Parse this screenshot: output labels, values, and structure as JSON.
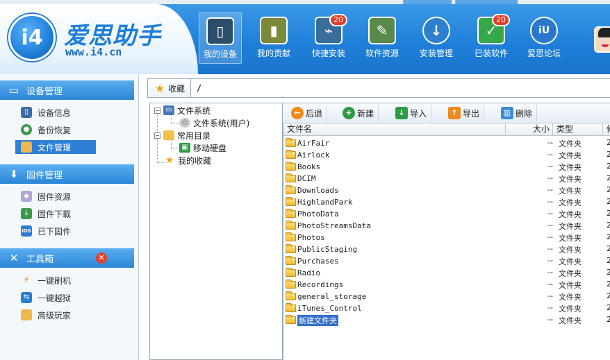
{
  "app": {
    "logo_mark": "i4",
    "title": "爱思助手",
    "url": "www.i4.cn"
  },
  "top_nav": [
    {
      "label": "我的设备",
      "icon": "phone-icon",
      "active": true,
      "badge": ""
    },
    {
      "label": "我的贡献",
      "icon": "chart-icon",
      "active": false,
      "badge": ""
    },
    {
      "label": "快捷安装",
      "icon": "usb-icon",
      "active": false,
      "badge": "20"
    },
    {
      "label": "软件资源",
      "icon": "tools-icon",
      "active": false,
      "badge": ""
    },
    {
      "label": "安装管理",
      "icon": "download-icon",
      "active": false,
      "badge": ""
    },
    {
      "label": "已装软件",
      "icon": "check-icon",
      "active": false,
      "badge": "20"
    },
    {
      "label": "爱思论坛",
      "icon": "forum-icon",
      "active": false,
      "badge": ""
    }
  ],
  "sidebar": {
    "device_section": {
      "header": "设备管理",
      "items": [
        {
          "label": "设备信息",
          "icon": "device-info-icon",
          "active": false
        },
        {
          "label": "备份恢复",
          "icon": "backup-icon",
          "active": false
        },
        {
          "label": "文件管理",
          "icon": "folder-icon",
          "active": true
        }
      ]
    },
    "firmware_section": {
      "header": "固件管理",
      "items": [
        {
          "label": "固件资源",
          "icon": "firmware-resource-icon",
          "active": false
        },
        {
          "label": "固件下载",
          "icon": "firmware-download-icon",
          "active": false
        },
        {
          "label": "已下固件",
          "icon": "ios-icon",
          "icon_text": "IOS",
          "active": false
        }
      ]
    },
    "tools_section": {
      "header": "工具箱",
      "items": [
        {
          "label": "一键刷机",
          "icon": "flash-icon",
          "active": false
        },
        {
          "label": "一键越狱",
          "icon": "jailbreak-icon",
          "active": false
        },
        {
          "label": "高级玩家",
          "icon": "advanced-icon",
          "active": false
        }
      ]
    }
  },
  "pathbar": {
    "favorites_label": "收藏",
    "path": "/"
  },
  "tree": {
    "nodes": [
      {
        "label": "文件系统",
        "level": 0,
        "toggle": "−",
        "icon": "computer-icon"
      },
      {
        "label": "文件系统(用户)",
        "level": 1,
        "toggle": "",
        "icon": "disk-icon"
      },
      {
        "label": "常用目录",
        "level": 0,
        "toggle": "−",
        "icon": "folder-icon"
      },
      {
        "label": "移动硬盘",
        "level": 1,
        "toggle": "",
        "icon": "usb-drive-icon"
      },
      {
        "label": "我的收藏",
        "level": 0,
        "toggle": "",
        "icon": "star-icon"
      }
    ]
  },
  "toolbar": {
    "back_label": "后退",
    "new_label": "新建",
    "import_label": "导入",
    "export_label": "导出",
    "delete_label": "删除"
  },
  "file_list": {
    "columns": {
      "name": "文件名",
      "size": "大小",
      "type": "类型",
      "date": "修"
    },
    "rows": [
      {
        "name": "AirFair",
        "size": "--",
        "type": "文件夹",
        "date": "2"
      },
      {
        "name": "Airlock",
        "size": "--",
        "type": "文件夹",
        "date": "2"
      },
      {
        "name": "Books",
        "size": "--",
        "type": "文件夹",
        "date": "2"
      },
      {
        "name": "DCIM",
        "size": "--",
        "type": "文件夹",
        "date": "2"
      },
      {
        "name": "Downloads",
        "size": "--",
        "type": "文件夹",
        "date": "2"
      },
      {
        "name": "HighlandPark",
        "size": "--",
        "type": "文件夹",
        "date": "2"
      },
      {
        "name": "PhotoData",
        "size": "--",
        "type": "文件夹",
        "date": "2"
      },
      {
        "name": "PhotoStreamsData",
        "size": "--",
        "type": "文件夹",
        "date": "2"
      },
      {
        "name": "Photos",
        "size": "--",
        "type": "文件夹",
        "date": "2"
      },
      {
        "name": "PublicStaging",
        "size": "--",
        "type": "文件夹",
        "date": "2"
      },
      {
        "name": "Purchases",
        "size": "--",
        "type": "文件夹",
        "date": "2"
      },
      {
        "name": "Radio",
        "size": "--",
        "type": "文件夹",
        "date": "2"
      },
      {
        "name": "Recordings",
        "size": "--",
        "type": "文件夹",
        "date": "2"
      },
      {
        "name": "general_storage",
        "size": "--",
        "type": "文件夹",
        "date": "2"
      },
      {
        "name": "iTunes_Control",
        "size": "--",
        "type": "文件夹",
        "date": "2"
      },
      {
        "name": "新建文件夹",
        "size": "--",
        "type": "文件夹",
        "date": "2",
        "selected": true
      }
    ]
  },
  "colors": {
    "brand_blue": "#1f7fd8",
    "badge_red": "#e53c2a",
    "selection_blue": "#3470c8"
  }
}
